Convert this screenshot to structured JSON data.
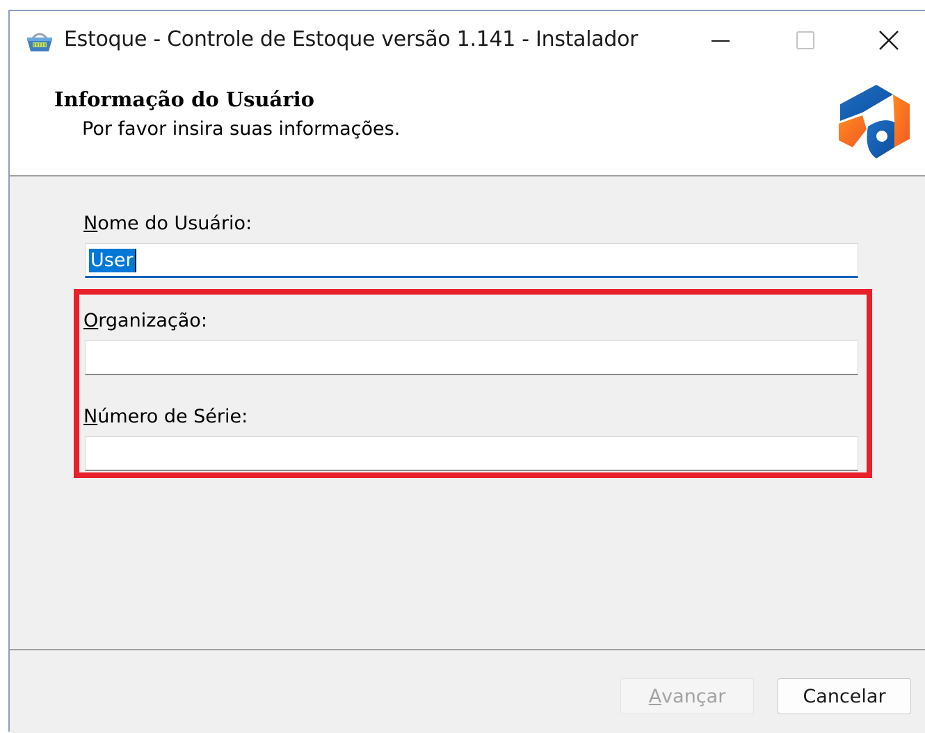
{
  "window": {
    "title": "Estoque - Controle de Estoque versão 1.141 - Instalador",
    "icon": "basket-icon",
    "controls": {
      "minimize": "minimize-icon",
      "maximize": "maximize-icon",
      "close": "close-icon"
    }
  },
  "header": {
    "title": "Informação do Usuário",
    "subtitle": "Por favor insira suas informações.",
    "logo": "installer-logo-icon"
  },
  "form": {
    "username": {
      "label_first": "N",
      "label_rest": "ome do Usuário:",
      "value": "User"
    },
    "organization": {
      "label_first": "O",
      "label_rest": "rganização:",
      "value": ""
    },
    "serial": {
      "label_first": "N",
      "label_rest": "úmero de Série:",
      "value": ""
    }
  },
  "footer": {
    "next_first": "A",
    "next_rest": "vançar",
    "cancel": "Cancelar"
  },
  "colors": {
    "highlight_border": "#e8202a",
    "focus_accent": "#005fb8",
    "selection": "#0078d7",
    "content_bg": "#f0f0f0"
  }
}
